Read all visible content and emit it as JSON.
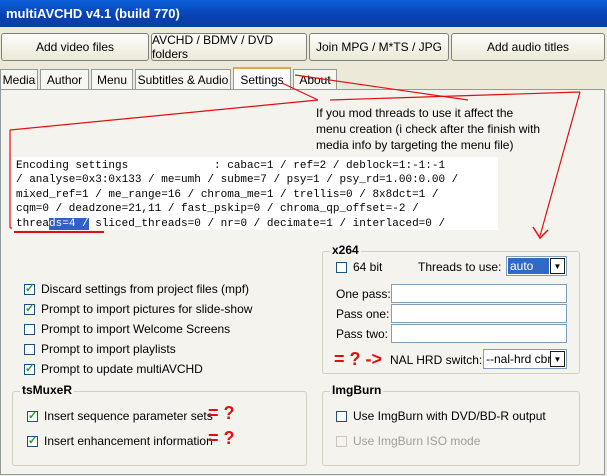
{
  "window": {
    "title": "multiAVCHD v4.1 (build 770)"
  },
  "toolbar": {
    "add_video": "Add video files",
    "avchd": "AVCHD / BDMV / DVD folders",
    "join": "Join MPG / M*TS / JPG",
    "add_audio": "Add audio titles"
  },
  "tabs": [
    "Media",
    "Author",
    "Menu",
    "Subtitles & Audio",
    "Settings",
    "About"
  ],
  "annotation": {
    "lines": [
      "If you mod threads to use it affect the",
      "menu creation (i check after the finish with",
      "media info by targeting the menu file)"
    ]
  },
  "encoding": {
    "line1": "Encoding settings             : cabac=1 / ref=2 / deblock=1:-1:-1",
    "line2": "/ analyse=0x3:0x133 / me=umh / subme=7 / psy=1 / psy_rd=1.00:0.00 /",
    "line3": "mixed_ref=1 / me_range=16 / chroma_me=1 / trellis=0 / 8x8dct=1 /",
    "line4": "cqm=0 / deadzone=21,11 / fast_pskip=0 / chroma_qp_offset=-2 /",
    "line5_a": "threa",
    "line5_hl": "ds=4 /",
    "line5_b": " sliced_threads=0 / nr=0 / decimate=1 / interlaced=0 /"
  },
  "options": {
    "discard": "Discard settings from project files (mpf)",
    "prompt_pictures": "Prompt to import pictures for slide-show",
    "prompt_welcome": "Prompt to import Welcome Screens",
    "prompt_playlists": "Prompt to import playlists",
    "prompt_update": "Prompt to update multiAVCHD"
  },
  "x264": {
    "title": "x264",
    "bit64": "64 bit",
    "threads_label": "Threads to use:",
    "threads_value": "auto",
    "one_pass": "One pass:",
    "pass_one": "Pass one:",
    "pass_two": "Pass two:",
    "nal_label": "NAL HRD switch:",
    "nal_value": "--nal-hrd cbr",
    "annot_marks": "= ? ->"
  },
  "tsmuxer": {
    "title": "tsMuxeR",
    "insert_sps": "Insert sequence parameter sets",
    "insert_enh": "Insert enhancement information",
    "mark": "= ?"
  },
  "imgburn": {
    "title": "ImgBurn",
    "use_dvd": "Use ImgBurn with DVD/BD-R output",
    "use_iso": "Use ImgBurn ISO mode"
  },
  "colors": {
    "annotation_red": "#e01010",
    "highlight": "#3161c5"
  }
}
